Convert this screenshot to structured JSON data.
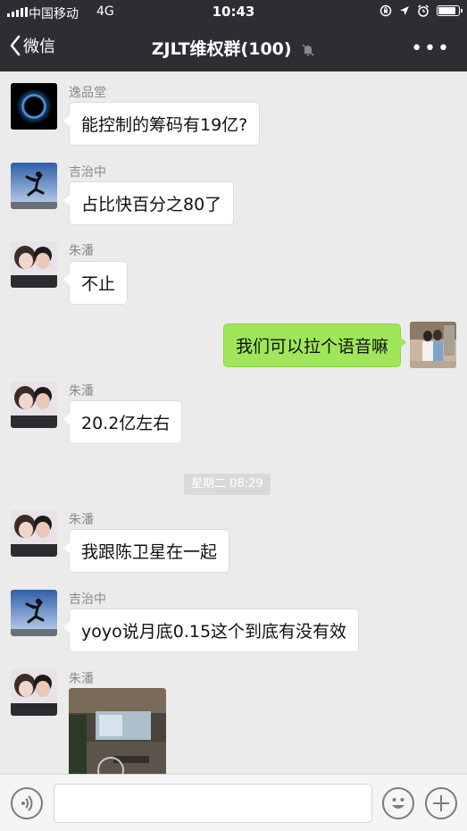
{
  "status_bar": {
    "carrier": "中国移动",
    "network": "4G",
    "time": "10:43",
    "battery_level": 0.9
  },
  "nav": {
    "back_label": "微信",
    "title": "ZJLT维权群(100)",
    "more_label": "•••"
  },
  "messages": [
    {
      "sender": "逸品堂",
      "text": "能控制的筹码有19亿?"
    },
    {
      "sender": "吉治中",
      "text": "占比快百分之80了"
    },
    {
      "sender": "朱潘",
      "text": "不止"
    },
    {
      "sender": "me",
      "text": "我们可以拉个语音嘛"
    },
    {
      "sender": "朱潘",
      "text": "20.2亿左右"
    },
    {
      "sender": "朱潘",
      "text": "我跟陈卫星在一起"
    },
    {
      "sender": "吉治中",
      "text": "yoyo说月底0.15这个到底有没有效"
    },
    {
      "sender": "朱潘",
      "type": "image"
    }
  ],
  "timestamp": "星期二 08:29",
  "input": {
    "placeholder": ""
  },
  "colors": {
    "nav_bg": "#2e2e32",
    "chat_bg": "#ebebeb",
    "own_bubble": "#9fe759",
    "other_bubble": "#ffffff"
  }
}
